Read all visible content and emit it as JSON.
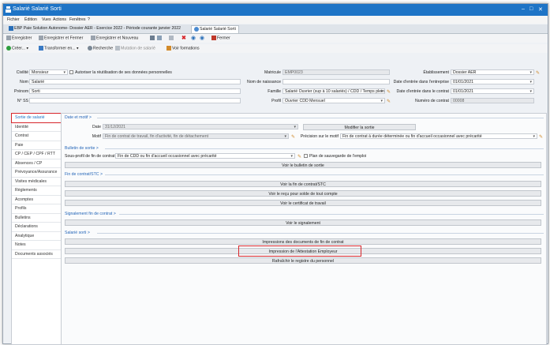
{
  "window": {
    "title": "Salarié Salarié Sorti",
    "controls": [
      "–",
      "□",
      "✕"
    ]
  },
  "menu": [
    "Fichier",
    "Édition",
    "Vues",
    "Actions",
    "Fenêtres",
    "?"
  ],
  "tabs": [
    {
      "label": "EBP Paie Solution Autonome- Dossier AER - Exercice 2022 - Période courante janvier 2022"
    },
    {
      "label": "Salarié Salarié Sorti"
    }
  ],
  "toolbar1": {
    "save": "Enregistrer",
    "save_close": "Enregistrer et Fermer",
    "save_new": "Enregistrer et Nouveau",
    "close": "Fermer"
  },
  "toolbar2": {
    "create": "Créer...",
    "transform": "Transformer en...",
    "search": "Recherche",
    "mutation": "Mutation de salarié",
    "trainings": "Voir formations"
  },
  "form": {
    "civilite_label": "Civilité",
    "civilite_value": "Monsieur",
    "reuse_label": "Autoriser la réutilisation de ses données personnelles",
    "matricule_label": "Matricule",
    "matricule_value": "EMP0023",
    "etab_label": "Établissement",
    "etab_value": "Dossier AER",
    "nom_label": "Nom",
    "nom_value": "Salarié",
    "naissance_label": "Nom de naissance",
    "naissance_value": "",
    "entree_ent_label": "Date d'entrée dans l'entreprise",
    "entree_ent_value": "01/01/2021",
    "prenom_label": "Prénom",
    "prenom_value": "Sorti",
    "famille_label": "Famille",
    "famille_value": "Salarié Ouvrier (sup à 10 salariés) / CDD / Temps plein",
    "entree_ctr_label": "Date d'entrée dans le contrat",
    "entree_ctr_value": "01/01/2021",
    "ss_label": "N° SS",
    "ss_value": "",
    "profil_label": "Profil",
    "profil_value": "Ouvrier CDD Mensuel",
    "numctr_label": "Numéro de contrat",
    "numctr_value": "00008"
  },
  "nav": [
    "Sortie de salarié",
    "Identité",
    "Contrat",
    "Paie",
    "CP / CEP / CPF / RTT",
    "Absences / CP",
    "Prévoyance/Assurance",
    "Visites médicales",
    "Règlements",
    "Acomptes",
    "Profils",
    "Bulletins",
    "Déclarations",
    "Analytique",
    "Notes",
    "Documents associés"
  ],
  "main": {
    "sec1_title": "Date et motif >",
    "date_label": "Date",
    "date_value": "31/12/2021",
    "modify_exit": "Modifier la sortie",
    "motif_label": "Motif",
    "motif_value": "Fin de contrat de travail, fin d'activité, fin de détachement",
    "precision_label": "Précision sur le motif",
    "precision_value": "Fin de contrat à durée déterminée ou fin d'accueil occasionnel avec précarité",
    "sec2_title": "Bulletin de sortie >",
    "sousprofil_label": "Sous-profil de fin de contrat",
    "sousprofil_value": "Fin de CDD ou fin d'accueil occasionnel avec précarité",
    "backup_label": "Plan de sauvegarde de l'emploi",
    "see_payslip": "Voir le bulletin de sortie",
    "sec3_title": "Fin de contrat/STC >",
    "see_end_contract": "Voir la fin de contrat/STC",
    "see_receipt": "Voir le reçu pour solde de tout compte",
    "see_certificate": "Voir le certificat de travail",
    "sec4_title": "Signalement fin de contrat >",
    "see_report": "Voir le signalement",
    "sec5_title": "Salarié sorti >",
    "print_docs": "Impressions des documents de fin de contrat",
    "print_attestation": "Impression de l'Attestation Employeur",
    "refresh_register": "Rafraîchir le registre du personnel"
  },
  "colors": {
    "title_blue": "#1e74c6",
    "highlight_red": "#d7262b",
    "section_blue": "#2566b8"
  }
}
